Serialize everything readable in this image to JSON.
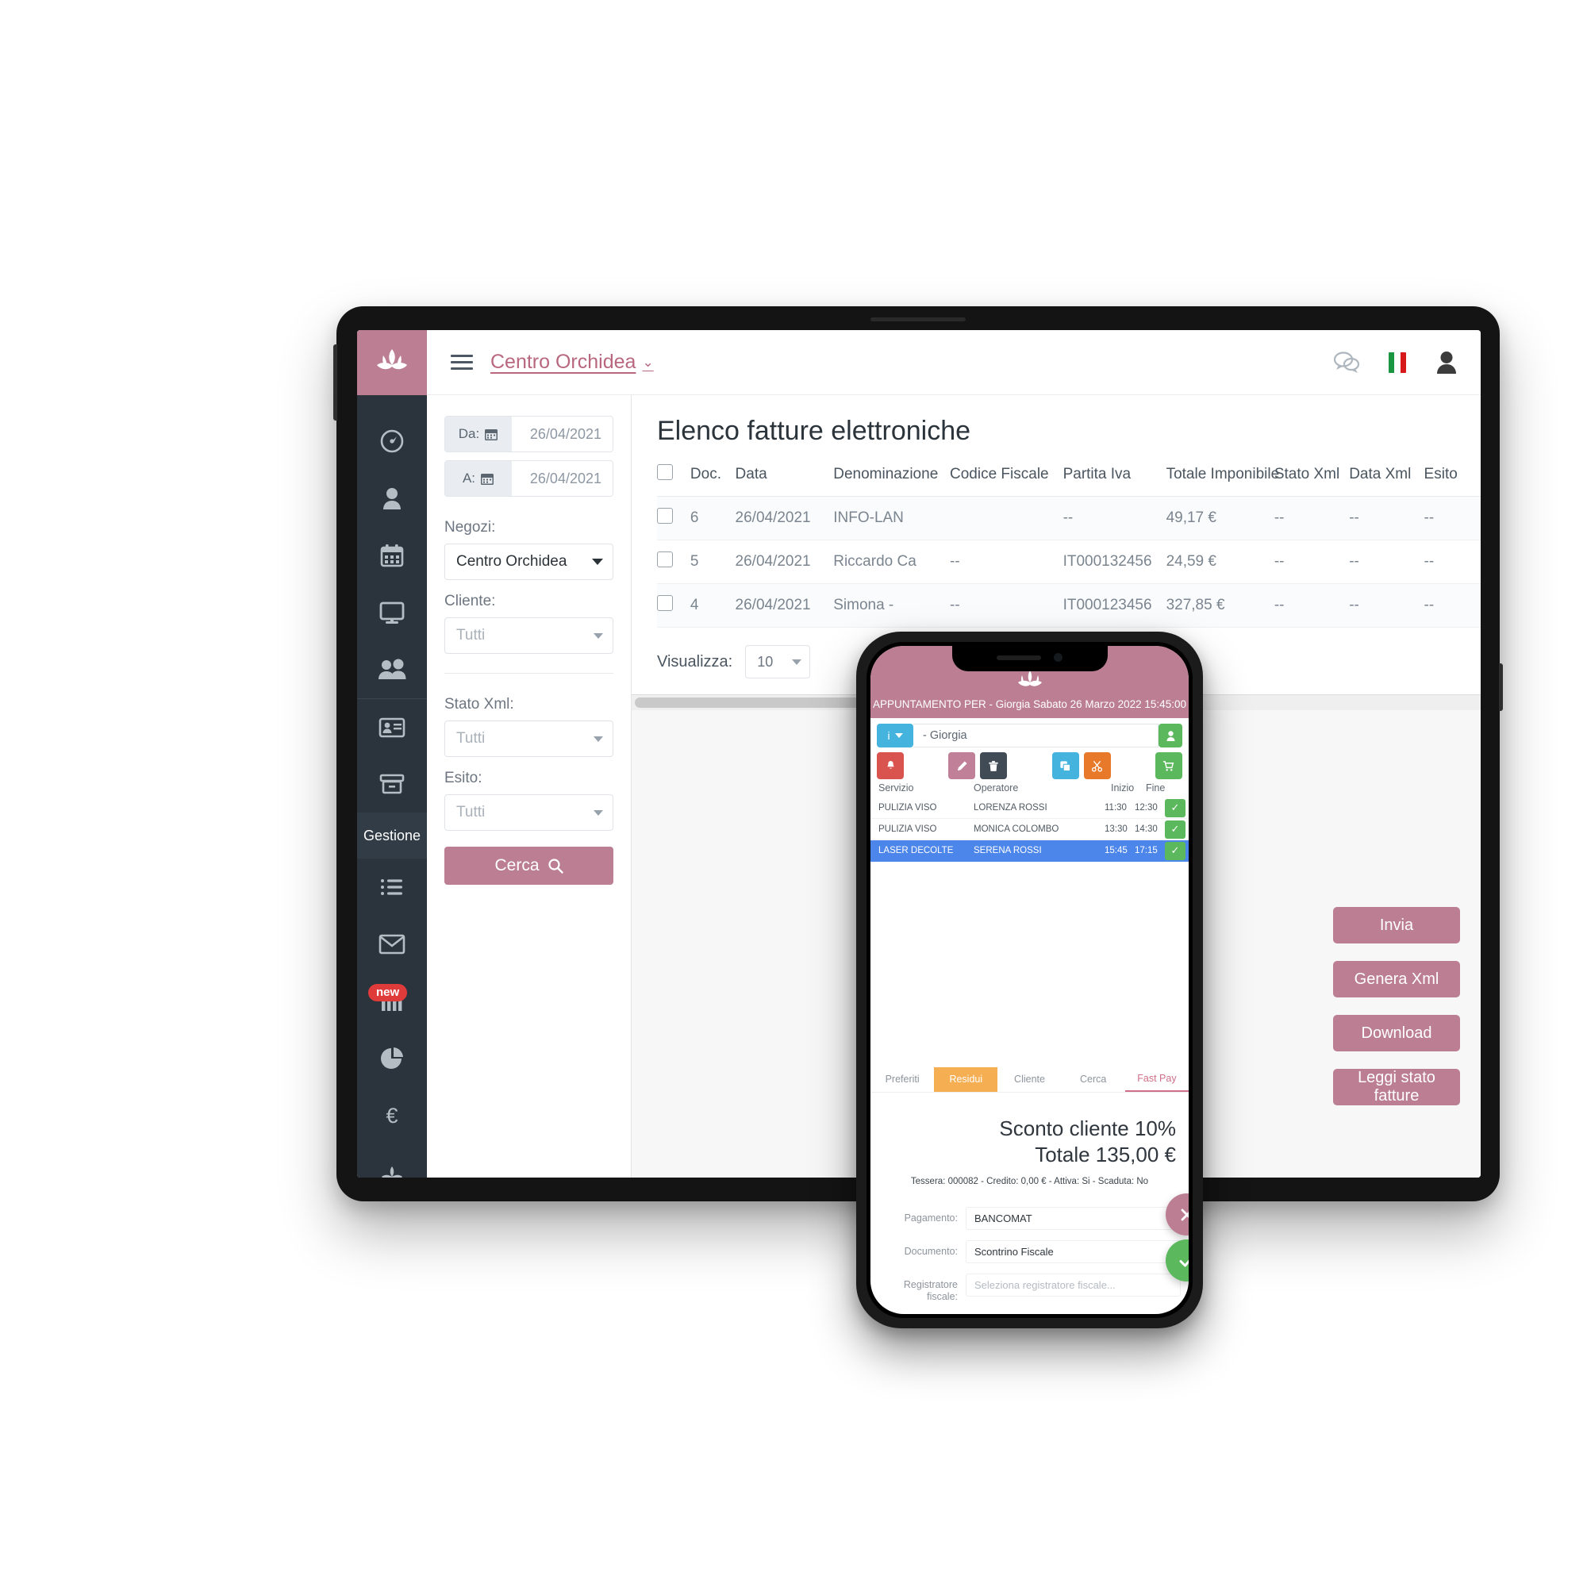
{
  "tablet": {
    "topbar": {
      "logo_icon": "lotus-logo-icon",
      "menu_icon": "hamburger-menu-icon",
      "shop_name": "Centro Orchidea",
      "caret": "⌄",
      "chat_icon": "chat-bubbles-icon",
      "language_flag": "italy-flag-icon",
      "user_icon": "user-avatar-icon"
    },
    "rail": {
      "items": [
        {
          "icon": "dashboard-gauge-icon",
          "name": "dashboard"
        },
        {
          "icon": "person-icon",
          "name": "clients"
        },
        {
          "icon": "calendar-icon",
          "name": "agenda"
        },
        {
          "icon": "monitor-icon",
          "name": "display"
        },
        {
          "icon": "people-group-icon",
          "name": "staff"
        },
        {
          "icon": "id-card-icon",
          "name": "cards"
        },
        {
          "icon": "archive-box-icon",
          "name": "warehouse"
        }
      ],
      "section_label": "Gestione",
      "items_lower": [
        {
          "icon": "list-icon",
          "name": "lists"
        },
        {
          "icon": "envelope-icon",
          "name": "messages"
        },
        {
          "icon": "bar-chart-icon",
          "name": "statistics",
          "badge": "new"
        },
        {
          "icon": "pie-chart-icon",
          "name": "reports"
        },
        {
          "icon": "euro-icon",
          "name": "accounting"
        }
      ]
    },
    "filters": {
      "date_from_label": "Da:",
      "date_from_value": "26/04/2021",
      "date_to_label": "A:",
      "date_to_value": "26/04/2021",
      "calendar_icon": "calendar-icon",
      "shops_label": "Negozi:",
      "shops_value": "Centro Orchidea",
      "client_label": "Cliente:",
      "client_value": "Tutti",
      "xml_state_label": "Stato Xml:",
      "xml_state_value": "Tutti",
      "outcome_label": "Esito:",
      "outcome_value": "Tutti",
      "search_button": "Cerca",
      "search_icon": "magnifier-icon"
    },
    "main": {
      "page_title": "Elenco fatture elettroniche",
      "columns": [
        "Doc.",
        "Data",
        "Denominazione",
        "Codice Fiscale",
        "Partita Iva",
        "Totale Imponibile",
        "Stato Xml",
        "Data Xml",
        "Esito"
      ],
      "rows": [
        {
          "doc": "6",
          "data": "26/04/2021",
          "denominazione": "INFO-LAN",
          "codice_fiscale": "",
          "partita_iva": "--",
          "totale": "49,17 €",
          "stato_xml": "--",
          "data_xml": "--",
          "esito": "--"
        },
        {
          "doc": "5",
          "data": "26/04/2021",
          "denominazione": "Riccardo Ca",
          "codice_fiscale": "--",
          "partita_iva": "IT000132456",
          "totale": "24,59 €",
          "stato_xml": "--",
          "data_xml": "--",
          "esito": "--"
        },
        {
          "doc": "4",
          "data": "26/04/2021",
          "denominazione": "Simona -",
          "codice_fiscale": "--",
          "partita_iva": "IT000123456",
          "totale": "327,85 €",
          "stato_xml": "--",
          "data_xml": "--",
          "esito": "--"
        }
      ],
      "show_label": "Visualizza:",
      "show_value": "10",
      "actions": [
        "Invia",
        "Genera Xml",
        "Download",
        "Leggi stato fatture"
      ]
    }
  },
  "phone": {
    "logo_icon": "lotus-logo-icon",
    "appointment_line": "APPUNTAMENTO PER - Giorgia Sabato 26 Marzo 2022 15:45:00",
    "info_button": "i",
    "client_value": "- Giorgia",
    "person_icon": "person-icon",
    "tools": [
      {
        "icon": "bell-icon",
        "color": "#d9534f",
        "name": "notify-button"
      },
      {
        "icon": "pencil-icon",
        "color": "#c08097",
        "name": "edit-button"
      },
      {
        "icon": "trash-icon",
        "color": "#414b55",
        "name": "delete-button"
      },
      {
        "icon": "copy-icon",
        "color": "#44b3dd",
        "name": "duplicate-button"
      },
      {
        "icon": "scissors-icon",
        "color": "#e8792a",
        "name": "cut-button"
      },
      {
        "icon": "cart-icon",
        "color": "#5cb85c",
        "name": "cart-button"
      }
    ],
    "col_service": "Servizio",
    "col_operator": "Operatore",
    "col_start": "Inizio",
    "col_end": "Fine",
    "services": [
      {
        "name": "PULIZIA VISO",
        "operator": "LORENZA ROSSI",
        "start": "11:30",
        "end": "12:30",
        "selected": false
      },
      {
        "name": "PULIZIA VISO",
        "operator": "MONICA COLOMBO",
        "start": "13:30",
        "end": "14:30",
        "selected": false
      },
      {
        "name": "LASER DECOLTE",
        "operator": "SERENA ROSSI",
        "start": "15:45",
        "end": "17:15",
        "selected": true
      }
    ],
    "tabs": [
      {
        "label": "Preferiti",
        "state": ""
      },
      {
        "label": "Residui",
        "state": "on"
      },
      {
        "label": "Cliente",
        "state": ""
      },
      {
        "label": "Cerca",
        "state": ""
      },
      {
        "label": "Fast Pay",
        "state": "act"
      }
    ],
    "discount_line": "Sconto cliente  10%",
    "total_line": "Totale 135,00 €",
    "card_line": "Tessera: 000082 - Credito: 0,00 € - Attiva: Si - Scaduta: No",
    "form": {
      "payment_label": "Pagamento:",
      "payment_value": "BANCOMAT",
      "document_label": "Documento:",
      "document_value": "Scontrino Fiscale",
      "register_label": "Registratore fiscale:",
      "register_placeholder": "Seleziona registratore fiscale..."
    },
    "cancel_icon": "close-x-icon",
    "confirm_icon": "check-icon"
  },
  "colors": {
    "brand": "#bc7e93",
    "rail": "#2b343d",
    "selected_row": "#4d86ea",
    "green": "#5cb85c",
    "orange": "#f5ae52",
    "badge_red": "#e03b3b"
  }
}
